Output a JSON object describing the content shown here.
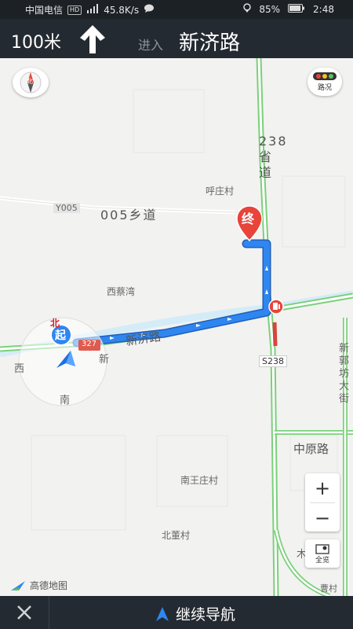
{
  "status_bar": {
    "carrier": "中国电信",
    "hd": "HD",
    "signal": "4G",
    "speed": "45.8K/s",
    "battery": "85%",
    "time": "2:48"
  },
  "nav": {
    "distance": "100米",
    "enter_text": "进入",
    "road_name": "新济路"
  },
  "map": {
    "compass_label": "北",
    "traffic_label": "路况",
    "zoom_in": "+",
    "zoom_out": "−",
    "overview_label": "全览",
    "logo_text": "高德地图",
    "start_label": "起",
    "start_north": "北",
    "end_label": "终",
    "road_labels": {
      "y005": "Y005",
      "xiangdao": "005乡道",
      "shengdao": "238省道",
      "xinji": "新济路",
      "zhongyuan": "中原路",
      "s238": "S238",
      "s227": "327",
      "xin_side": "新",
      "side_right": "新郭坊大街"
    },
    "places": {
      "huzhuang": "呼庄村",
      "xicaiwan": "西蔡湾",
      "nanwang": "南王庄村",
      "beidong": "北董村",
      "caocun": "曹村",
      "mo": "木",
      "xi": "西",
      "nan": "南"
    },
    "colors": {
      "route": "#2f86f0",
      "route_border": "#1f5fb8",
      "road_green": "#7bd07b",
      "water": "#d4ecf7",
      "marker_red": "#e8443a"
    }
  },
  "bottom": {
    "close_label": "×",
    "continue_label": "继续导航"
  }
}
